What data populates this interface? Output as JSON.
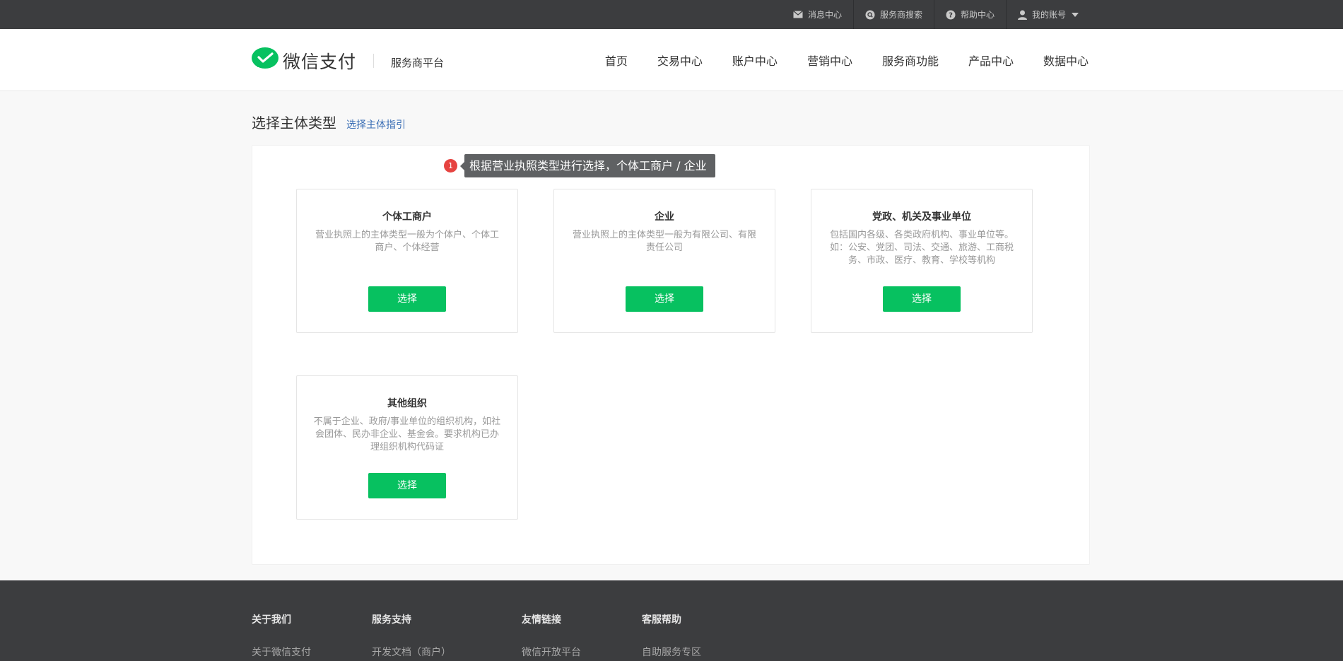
{
  "topbar": {
    "items": [
      {
        "label": "消息中心",
        "icon": "mail-icon"
      },
      {
        "label": "服务商搜索",
        "icon": "search-icon"
      },
      {
        "label": "帮助中心",
        "icon": "help-icon"
      },
      {
        "label": "我的账号",
        "icon": "user-icon"
      }
    ]
  },
  "header": {
    "logo_text": "微信支付",
    "platform": "服务商平台",
    "nav": [
      "首页",
      "交易中心",
      "账户中心",
      "营销中心",
      "服务商功能",
      "产品中心",
      "数据中心"
    ]
  },
  "main": {
    "title": "选择主体类型",
    "guide_link": "选择主体指引",
    "tip_number": "1",
    "tip_text": "根据营业执照类型进行选择，个体工商户 / 企业",
    "cards": [
      {
        "title": "个体工商户",
        "desc": "营业执照上的主体类型一般为个体户、个体工商户、个体经营",
        "button": "选择"
      },
      {
        "title": "企业",
        "desc": "营业执照上的主体类型一般为有限公司、有限责任公司",
        "button": "选择"
      },
      {
        "title": "党政、机关及事业单位",
        "desc": "包括国内各级、各类政府机构、事业单位等。如：公安、党团、司法、交通、旅游、工商税务、市政、医疗、教育、学校等机构",
        "button": "选择"
      },
      {
        "title": "其他组织",
        "desc": "不属于企业、政府/事业单位的组织机构，如社会团体、民办非企业、基金会。要求机构已办理组织机构代码证",
        "button": "选择"
      }
    ]
  },
  "footer": {
    "columns": [
      {
        "head": "关于我们",
        "link": "关于微信支付"
      },
      {
        "head": "服务支持",
        "link": "开发文档（商户）"
      },
      {
        "head": "友情链接",
        "link": "微信开放平台"
      },
      {
        "head": "客服帮助",
        "link": "自助服务专区"
      }
    ]
  },
  "colors": {
    "brand_green": "#07c160",
    "topbar_bg": "#3c3d3f",
    "link_blue": "#3a6eb5",
    "badge_red": "#e64340"
  }
}
